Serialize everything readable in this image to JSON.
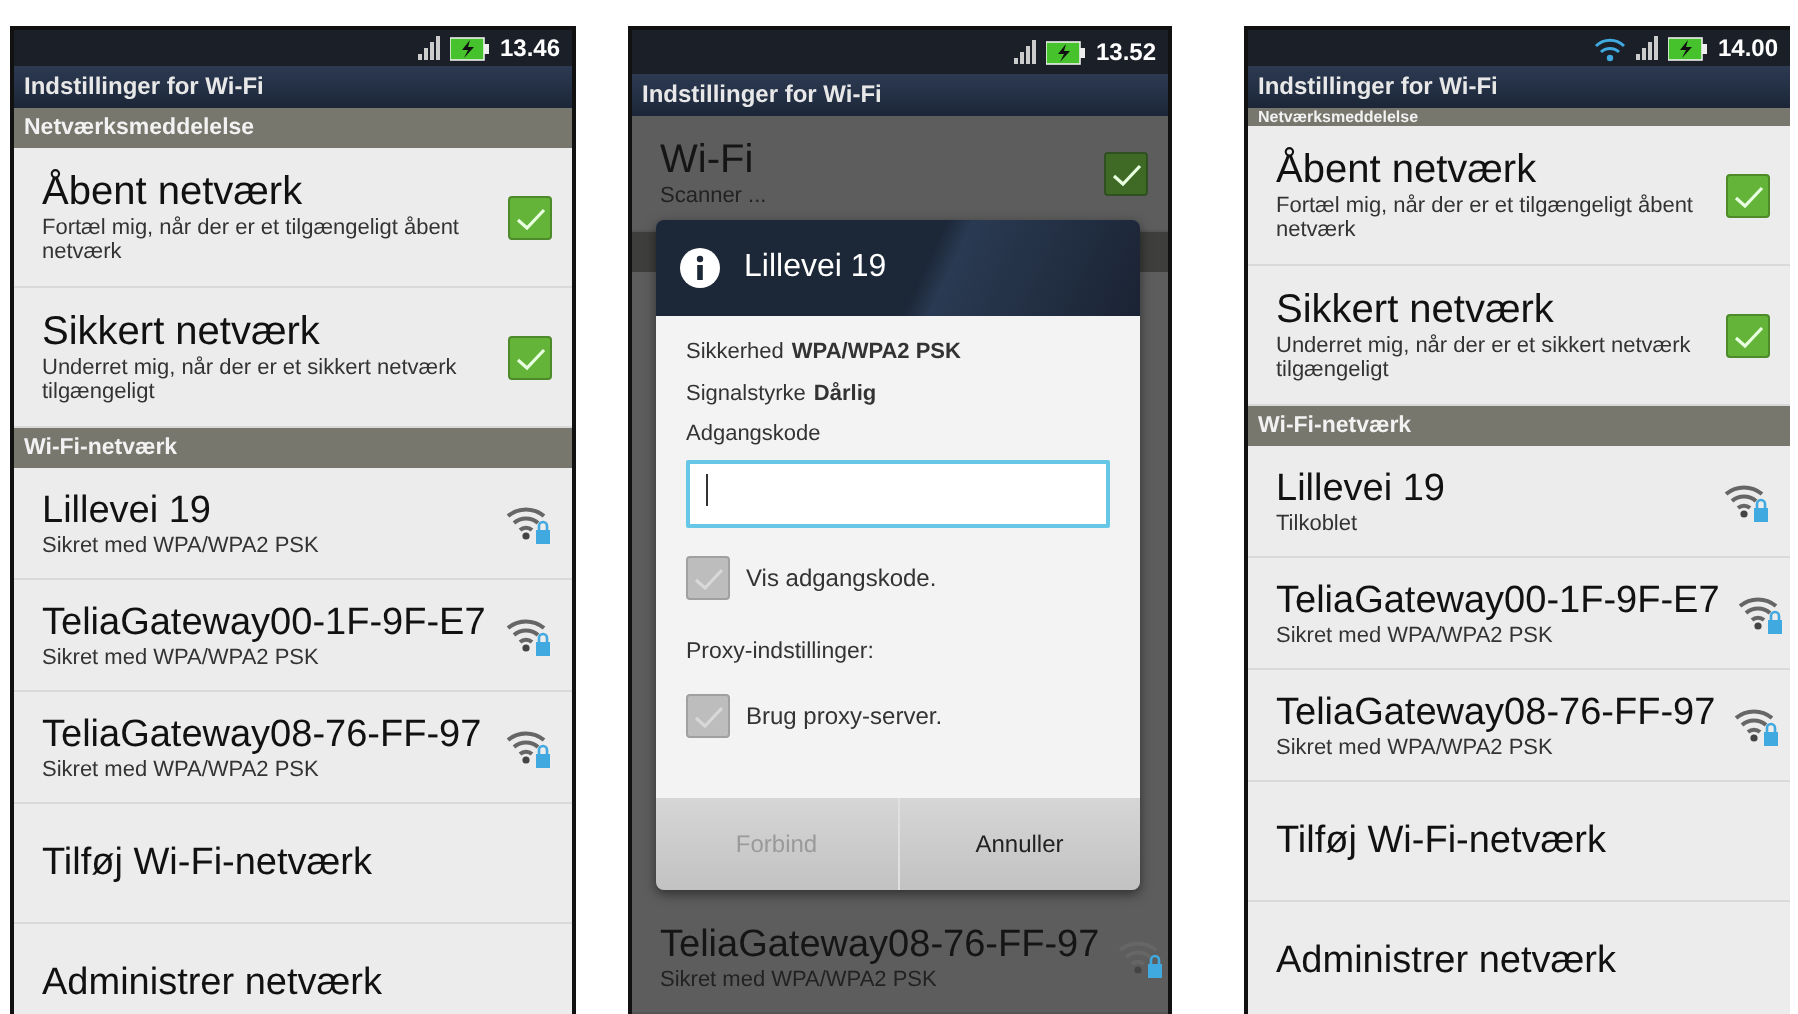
{
  "phones": [
    {
      "status_bar": {
        "wifi_connected": false,
        "time": "13.46"
      },
      "title": "Indstillinger for Wi-Fi",
      "dimmed": false,
      "items": [
        {
          "kind": "header",
          "label": "Netværksmeddelelse"
        },
        {
          "kind": "check",
          "title": "Åbent netværk",
          "subtitle": "Fortæl mig, når der er et tilgængeligt åbent netværk",
          "checked": true
        },
        {
          "kind": "check",
          "title": "Sikkert netværk",
          "subtitle": "Underret mig, når der er et sikkert netværk tilgængeligt",
          "checked": true
        },
        {
          "kind": "header",
          "label": "Wi-Fi-netværk"
        },
        {
          "kind": "network",
          "title": "Lillevei 19",
          "subtitle": "Sikret med WPA/WPA2 PSK"
        },
        {
          "kind": "network",
          "title": "TeliaGateway00-1F-9F-E7",
          "subtitle": "Sikret med WPA/WPA2 PSK"
        },
        {
          "kind": "network",
          "title": "TeliaGateway08-76-FF-97",
          "subtitle": "Sikret med WPA/WPA2 PSK"
        },
        {
          "kind": "action",
          "title": "Tilføj Wi-Fi-netværk"
        },
        {
          "kind": "action",
          "title": "Administrer netværk"
        }
      ]
    },
    {
      "status_bar": {
        "wifi_connected": false,
        "time": "13.52"
      },
      "title": "Indstillinger for Wi-Fi",
      "dimmed": true,
      "items": [
        {
          "kind": "check",
          "title": "Wi-Fi",
          "subtitle": "Scanner ...",
          "checked": true
        },
        {
          "kind": "header"
        },
        {
          "kind": "gap"
        },
        {
          "kind": "network",
          "title": "TeliaGateway08-76-FF-97",
          "subtitle": "Sikret med WPA/WPA2 PSK"
        }
      ],
      "dialog": {
        "title": "Lillevei 19",
        "details": [
          {
            "label": "Sikkerhed",
            "value": "WPA/WPA2 PSK"
          },
          {
            "label": "Signalstyrke",
            "value": "Dårlig"
          }
        ],
        "password_label": "Adgangskode",
        "password_focused": true,
        "options": [
          {
            "kind": "check",
            "label": "Vis adgangskode.",
            "checked": false
          },
          {
            "kind": "label",
            "label": "Proxy-indstillinger:"
          },
          {
            "kind": "check",
            "label": "Brug proxy-server.",
            "checked": false
          }
        ],
        "buttons": [
          {
            "label": "Forbind",
            "disabled": true
          },
          {
            "label": "Annuller",
            "disabled": false
          }
        ]
      }
    },
    {
      "status_bar": {
        "wifi_connected": true,
        "time": "14.00"
      },
      "title": "Indstillinger for Wi-Fi",
      "dimmed": false,
      "items": [
        {
          "kind": "header",
          "label": "Netværksmeddelelse",
          "cut": true
        },
        {
          "kind": "check",
          "title": "Åbent netværk",
          "subtitle": "Fortæl mig, når der er et tilgængeligt åbent netværk",
          "checked": true
        },
        {
          "kind": "check",
          "title": "Sikkert netværk",
          "subtitle": "Underret mig, når der er et sikkert netværk tilgængeligt",
          "checked": true
        },
        {
          "kind": "header",
          "label": "Wi-Fi-netværk"
        },
        {
          "kind": "network",
          "title": "Lillevei 19",
          "subtitle": "Tilkoblet"
        },
        {
          "kind": "network",
          "title": "TeliaGateway00-1F-9F-E7",
          "subtitle": "Sikret med WPA/WPA2 PSK"
        },
        {
          "kind": "network",
          "title": "TeliaGateway08-76-FF-97",
          "subtitle": "Sikret med WPA/WPA2 PSK"
        },
        {
          "kind": "action",
          "title": "Tilføj Wi-Fi-netværk"
        },
        {
          "kind": "action",
          "title": "Administrer netværk"
        }
      ]
    }
  ]
}
